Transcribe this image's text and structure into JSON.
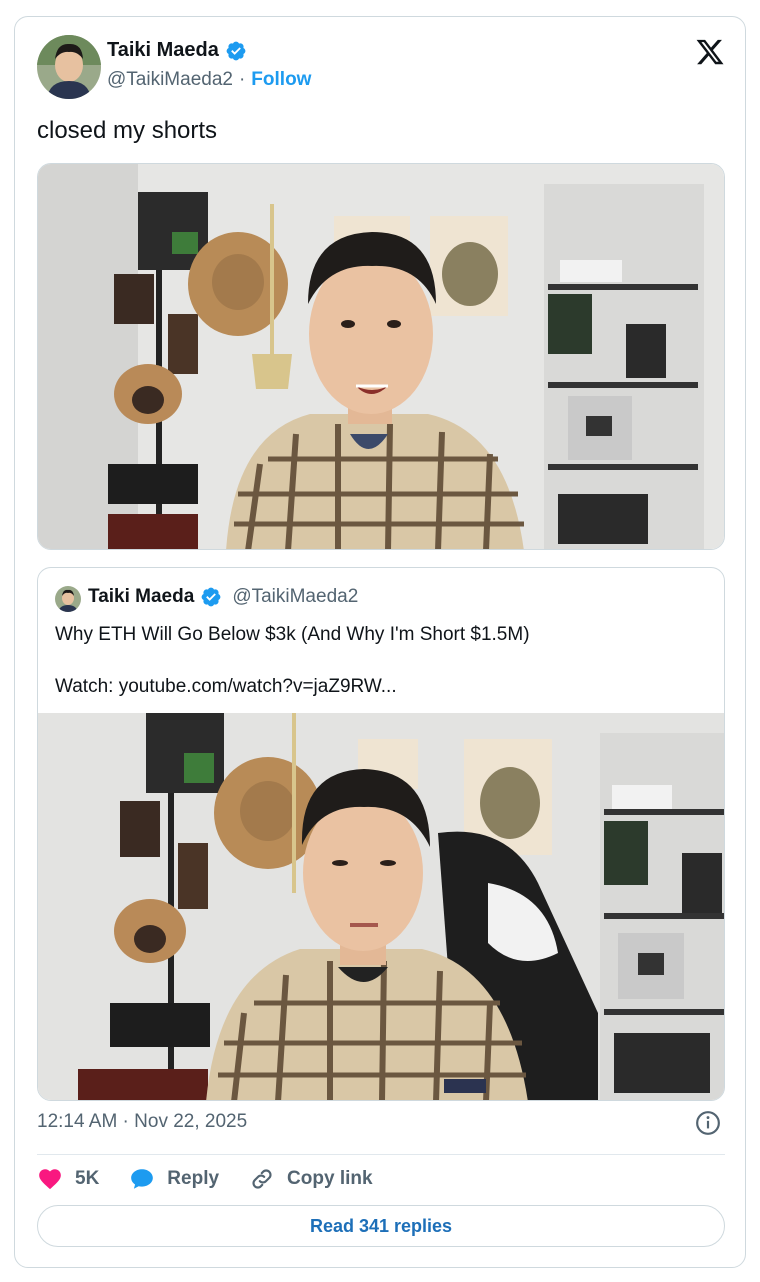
{
  "author": {
    "name": "Taiki Maeda",
    "handle": "@TaikiMaeda2",
    "separator": "·",
    "follow_label": "Follow"
  },
  "tweet": {
    "text": "closed my shorts",
    "timestamp": "12:14 AM · Nov 22, 2025"
  },
  "quote": {
    "name": "Taiki Maeda",
    "handle": "@TaikiMaeda2",
    "line1": "Why ETH Will Go Below $3k (And Why I'm Short $1.5M)",
    "line2": "Watch: youtube.com/watch?v=jaZ9RW..."
  },
  "actions": {
    "likes": "5K",
    "reply_label": "Reply",
    "copy_label": "Copy link",
    "read_replies": "Read 341 replies"
  },
  "icons": {
    "verified": "verified-badge-icon",
    "logo": "x-logo-icon",
    "like": "heart-icon",
    "reply": "reply-bubble-icon",
    "copy": "link-icon",
    "info": "info-icon"
  },
  "colors": {
    "accent": "#1d9bf0",
    "like": "#f91880",
    "muted": "#536471",
    "border": "#cfd9de"
  }
}
